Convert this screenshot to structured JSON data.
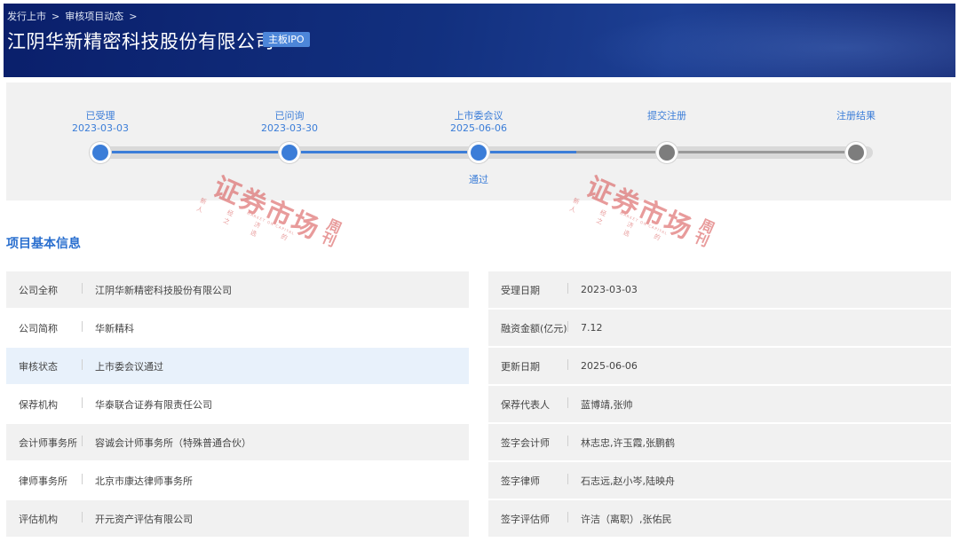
{
  "breadcrumb": {
    "items": [
      "发行上市",
      "审核项目动态"
    ],
    "separator": ">"
  },
  "header": {
    "title": "江阴华新精密科技股份有限公司",
    "badge": "主板IPO"
  },
  "progress": {
    "steps": [
      {
        "label": "已受理",
        "date": "2023-03-03",
        "status": "done"
      },
      {
        "label": "已问询",
        "date": "2023-03-30",
        "status": "done"
      },
      {
        "label": "上市委会议",
        "date": "2025-06-06",
        "status": "done",
        "result": "通过"
      },
      {
        "label": "提交注册",
        "date": "",
        "status": "todo"
      },
      {
        "label": "注册结果",
        "date": "",
        "status": "todo"
      }
    ],
    "colors": {
      "done": "#3b7dd8",
      "todo": "#7d7d7d"
    }
  },
  "watermark": {
    "main": "证券市场",
    "side": "周刊",
    "sub": "新 经 济 的 人 之 选",
    "tiny": "MARKET ON CAPITAL"
  },
  "section": {
    "title": "项目基本信息"
  },
  "info": {
    "left": [
      {
        "key": "公司全称",
        "value": "江阴华新精密科技股份有限公司"
      },
      {
        "key": "公司简称",
        "value": "华新精科"
      },
      {
        "key": "审核状态",
        "value": "上市委会议通过"
      },
      {
        "key": "保荐机构",
        "value": "华泰联合证券有限责任公司"
      },
      {
        "key": "会计师事务所",
        "value": "容诚会计师事务所（特殊普通合伙）"
      },
      {
        "key": "律师事务所",
        "value": "北京市康达律师事务所"
      },
      {
        "key": "评估机构",
        "value": "开元资产评估有限公司"
      }
    ],
    "right": [
      {
        "key": "受理日期",
        "value": "2023-03-03"
      },
      {
        "key": "融资金额(亿元)",
        "value": "7.12"
      },
      {
        "key": "更新日期",
        "value": "2025-06-06"
      },
      {
        "key": "保荐代表人",
        "value": "蓝博靖,张帅"
      },
      {
        "key": "签字会计师",
        "value": "林志忠,许玉霞,张鹏鹤"
      },
      {
        "key": "签字律师",
        "value": "石志远,赵小岑,陆映舟"
      },
      {
        "key": "签字评估师",
        "value": "许洁（离职）,张佑民"
      }
    ]
  }
}
